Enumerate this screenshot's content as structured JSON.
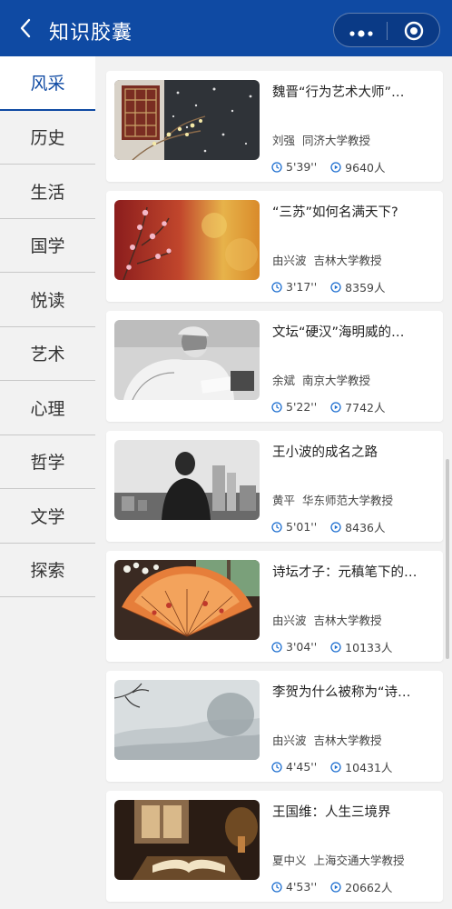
{
  "header": {
    "title": "知识胶囊",
    "back_icon": "chevron-left-icon",
    "more_icon": "more-dots-icon",
    "capsule_icon": "target-circle-icon",
    "bg_color": "#0f4aa3"
  },
  "sidebar": {
    "items": [
      {
        "label": "风采",
        "active": true
      },
      {
        "label": "历史"
      },
      {
        "label": "生活"
      },
      {
        "label": "国学"
      },
      {
        "label": "悦读"
      },
      {
        "label": "艺术"
      },
      {
        "label": "心理"
      },
      {
        "label": "哲学"
      },
      {
        "label": "文学"
      },
      {
        "label": "探索"
      }
    ]
  },
  "cards": [
    {
      "title": "魏晋“行为艺术大师”…",
      "author": "刘强",
      "role": "同济大学教授",
      "duration": "5'39''",
      "views": "9640人"
    },
    {
      "title": "“三苏”如何名满天下?",
      "author": "由兴波",
      "role": "吉林大学教授",
      "duration": "3'17''",
      "views": "8359人"
    },
    {
      "title": "文坛“硬汉”海明威的…",
      "author": "余斌",
      "role": "南京大学教授",
      "duration": "5'22''",
      "views": "7742人"
    },
    {
      "title": "王小波的成名之路",
      "author": "黄平",
      "role": "华东师范大学教授",
      "duration": "5'01''",
      "views": "8436人"
    },
    {
      "title": "诗坛才子：元稹笔下的…",
      "author": "由兴波",
      "role": "吉林大学教授",
      "duration": "3'04''",
      "views": "10133人"
    },
    {
      "title": "李贺为什么被称为“诗…",
      "author": "由兴波",
      "role": "吉林大学教授",
      "duration": "4'45''",
      "views": "10431人"
    },
    {
      "title": "王国维：人生三境界",
      "author": "夏中义",
      "role": "上海交通大学教授",
      "duration": "4'53''",
      "views": "20662人"
    }
  ],
  "accent_color": "#1e6fd0"
}
